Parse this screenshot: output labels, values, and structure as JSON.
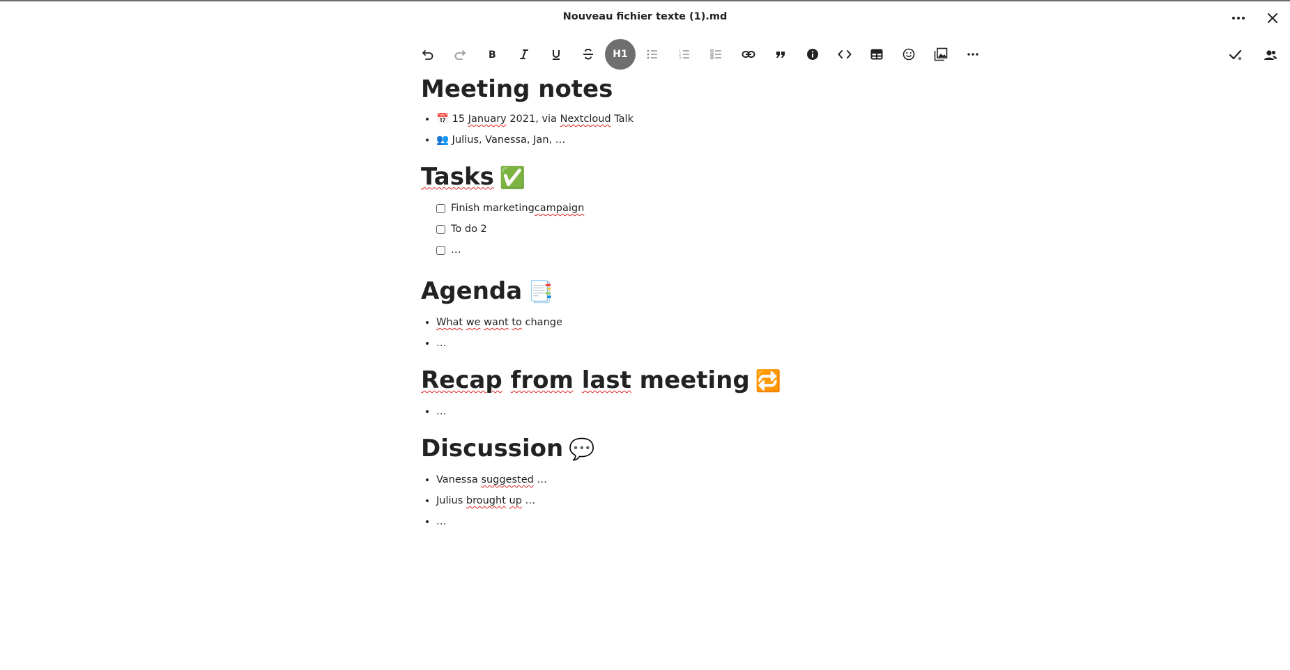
{
  "window": {
    "title": "Nouveau fichier texte (1).md"
  },
  "toolbar": {
    "heading_label": "H1",
    "buttons": [
      "undo-icon",
      "redo-icon",
      "bold-icon",
      "italic-icon",
      "underline-icon",
      "strikethrough-icon",
      "heading-icon",
      "bullet-list-icon",
      "ordered-list-icon",
      "task-list-icon",
      "link-icon",
      "blockquote-icon",
      "info-icon",
      "code-block-icon",
      "table-icon",
      "emoji-icon",
      "image-icon",
      "more-icon"
    ]
  },
  "doc": {
    "title": "Meeting notes",
    "meta": [
      {
        "icon": "📅",
        "pre": "15 ",
        "w1": "January",
        "mid": " 2021, via ",
        "w2": "Nextcloud",
        "post": " Talk"
      },
      {
        "icon": "👥",
        "text": "Julius, Vanessa, Jan, …"
      }
    ],
    "tasks_heading": "Tasks",
    "tasks_emoji": "✅",
    "tasks": [
      {
        "pre": "Finish marketing ",
        "spell": "campaign",
        "checked": false
      },
      {
        "pre": "To do 2",
        "spell": "",
        "checked": false
      },
      {
        "pre": "…",
        "spell": "",
        "checked": false
      }
    ],
    "agenda_heading": "Agenda",
    "agenda_emoji": "📑",
    "agenda": [
      {
        "s1": "What",
        "t1": " ",
        "s2": "we",
        "t2": " ",
        "s3": "want",
        "t3": " ",
        "s4": "to",
        "t4": " change"
      },
      {
        "text": "…"
      }
    ],
    "recap_heading_parts": [
      "Recap",
      " ",
      "from",
      " ",
      "last",
      " meeting"
    ],
    "recap_emoji": "🔁",
    "recap": [
      "…"
    ],
    "discussion_heading": "Discussion",
    "discussion_emoji": "💬",
    "discussion": [
      {
        "pre": "Vanessa ",
        "spell": "suggested",
        "post": " …"
      },
      {
        "pre": "Julius ",
        "spell": "brought",
        "mid": " ",
        "spell2": "up",
        "post": " …"
      },
      {
        "pre": "…"
      }
    ]
  },
  "colors": {
    "accent_active": "#6f6f6f",
    "spellcheck": "#e02020",
    "text": "#222222",
    "icon_muted": "#9a9a9a"
  }
}
